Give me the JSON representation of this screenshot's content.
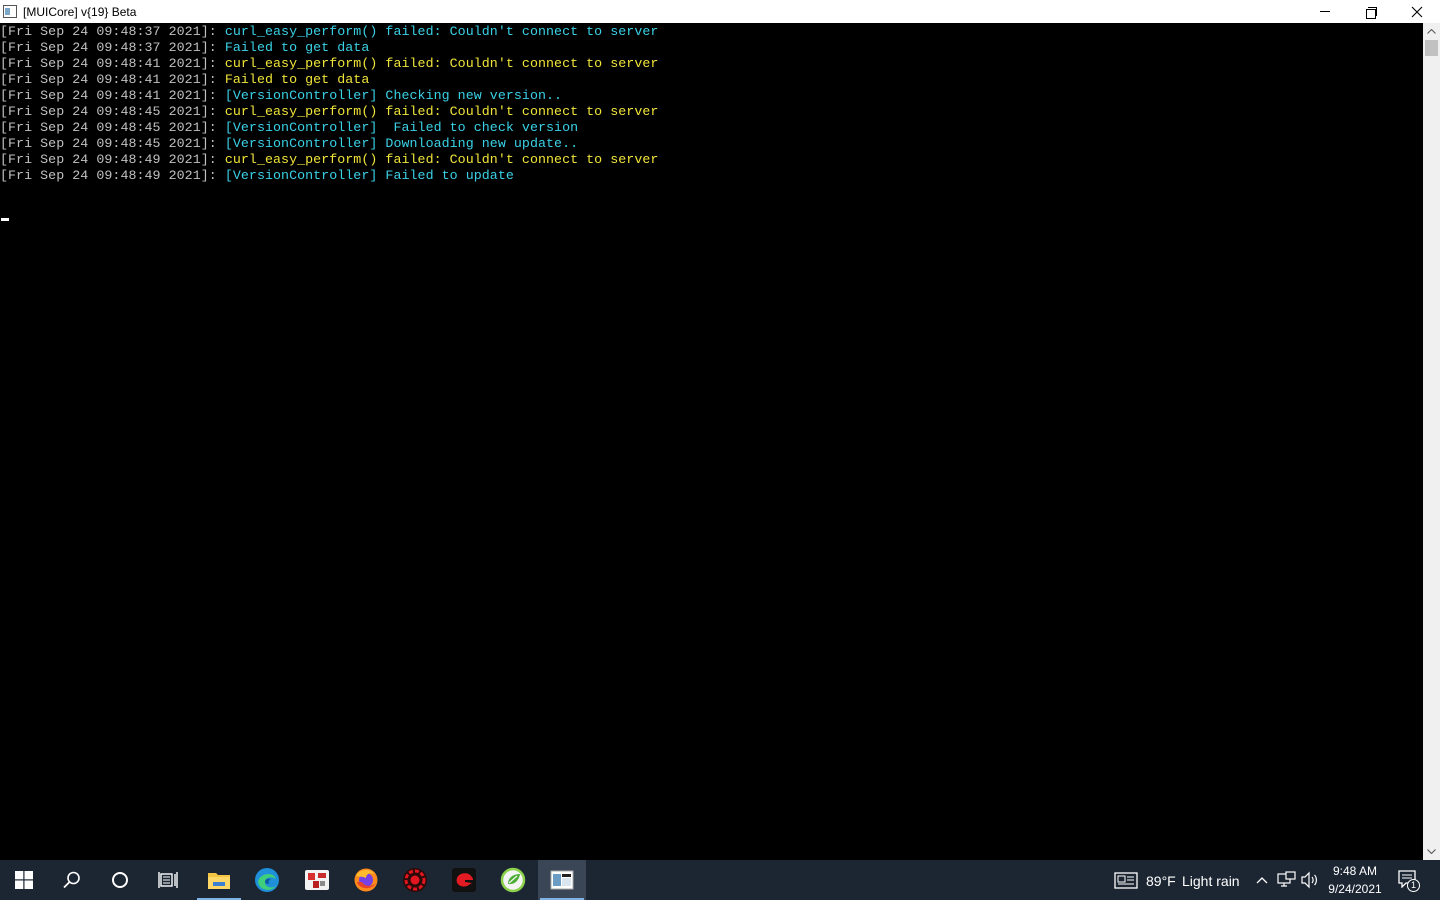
{
  "window": {
    "title": "[MUICore] v{19} Beta"
  },
  "console": {
    "lines": [
      {
        "ts": "[Fri Sep 24 09:48:37 2021]: ",
        "msg": "curl_easy_perform() failed: Couldn't connect to server",
        "color": "#3ad1e6"
      },
      {
        "ts": "[Fri Sep 24 09:48:37 2021]: ",
        "msg": "Failed to get data",
        "color": "#3ad1e6"
      },
      {
        "ts": "[Fri Sep 24 09:48:41 2021]: ",
        "msg": "curl_easy_perform() failed: Couldn't connect to server",
        "color": "#f0e43a"
      },
      {
        "ts": "[Fri Sep 24 09:48:41 2021]: ",
        "msg": "Failed to get data",
        "color": "#f0e43a"
      },
      {
        "ts": "[Fri Sep 24 09:48:41 2021]: ",
        "msg": "[VersionController] Checking new version..",
        "color": "#3ad1e6"
      },
      {
        "ts": "[Fri Sep 24 09:48:45 2021]: ",
        "msg": "curl_easy_perform() failed: Couldn't connect to server",
        "color": "#f0e43a"
      },
      {
        "ts": "[Fri Sep 24 09:48:45 2021]: ",
        "msg": "[VersionController]  Failed to check version",
        "color": "#3ad1e6"
      },
      {
        "ts": "[Fri Sep 24 09:48:45 2021]: ",
        "msg": "[VersionController] Downloading new update..",
        "color": "#3ad1e6"
      },
      {
        "ts": "[Fri Sep 24 09:48:49 2021]: ",
        "msg": "curl_easy_perform() failed: Couldn't connect to server",
        "color": "#f0e43a"
      },
      {
        "ts": "[Fri Sep 24 09:48:49 2021]: ",
        "msg": "[VersionController] Failed to update",
        "color": "#3ad1e6"
      }
    ]
  },
  "taskbar": {
    "items": [
      {
        "name": "start-button",
        "icon": "windows-logo-icon"
      },
      {
        "name": "search-button",
        "icon": "search-icon"
      },
      {
        "name": "cortana-button",
        "icon": "cortana-circle-icon"
      },
      {
        "name": "task-view-button",
        "icon": "task-view-icon"
      },
      {
        "name": "file-explorer-button",
        "icon": "folder-icon"
      },
      {
        "name": "edge-button",
        "icon": "edge-icon"
      },
      {
        "name": "app-puzzle-button",
        "icon": "puzzle-app-icon"
      },
      {
        "name": "firefox-button",
        "icon": "firefox-icon"
      },
      {
        "name": "red-app-button",
        "icon": "red-gear-app-icon"
      },
      {
        "name": "garena-button",
        "icon": "garena-icon"
      },
      {
        "name": "green-app-button",
        "icon": "green-leaf-app-icon"
      },
      {
        "name": "console-window-button",
        "icon": "console-window-icon"
      }
    ],
    "weather": {
      "temp": "89°F",
      "condition": "Light rain"
    },
    "clock": {
      "time": "9:48 AM",
      "date": "9/24/2021"
    },
    "notification_count": "1"
  }
}
